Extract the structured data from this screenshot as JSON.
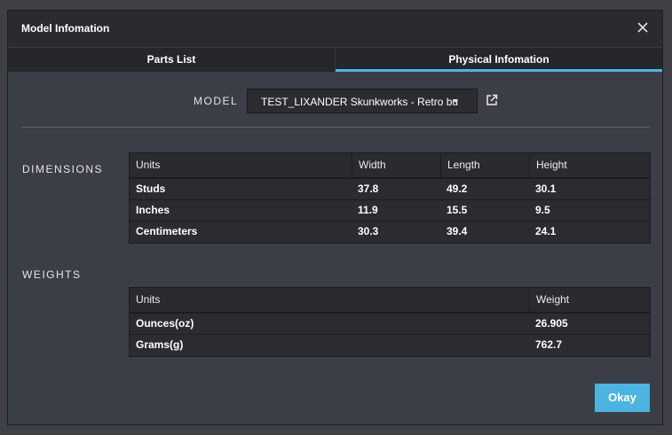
{
  "dialog": {
    "title": "Model Infomation",
    "close_icon": "close-icon"
  },
  "tabs": [
    {
      "label": "Parts List",
      "active": false
    },
    {
      "label": "Physical Infomation",
      "active": true
    }
  ],
  "model": {
    "label": "MODEL",
    "selected": "TEST_LIXANDER Skunkworks - Retro bug",
    "caret_icon": "caret-down-icon",
    "link_icon": "external-link-icon"
  },
  "dimensions": {
    "label": "DIMENSIONS",
    "headers": [
      "Units",
      "Width",
      "Length",
      "Height"
    ],
    "rows": [
      [
        "Studs",
        "37.8",
        "49.2",
        "30.1"
      ],
      [
        "Inches",
        "11.9",
        "15.5",
        "9.5"
      ],
      [
        "Centimeters",
        "30.3",
        "39.4",
        "24.1"
      ]
    ]
  },
  "weights": {
    "label": "WEIGHTS",
    "headers": [
      "Units",
      "Weight"
    ],
    "rows": [
      [
        "Ounces(oz)",
        "26.905"
      ],
      [
        "Grams(g)",
        "762.7"
      ]
    ]
  },
  "footer": {
    "okay_label": "Okay"
  },
  "colors": {
    "accent": "#4db3e0",
    "background": "#3b3e47",
    "titlebar": "#2a2b2f"
  }
}
